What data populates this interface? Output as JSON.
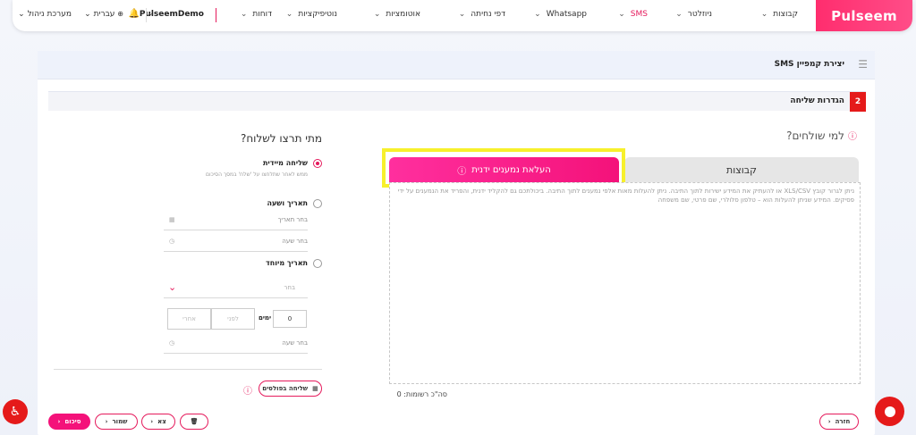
{
  "brand": {
    "logo": "Pulseem",
    "accent": "#e51a5c"
  },
  "nav": {
    "items": [
      {
        "label": "קבוצות"
      },
      {
        "label": "ניוזלטר"
      },
      {
        "label": "SMS"
      },
      {
        "label": "Whatsapp"
      },
      {
        "label": "דפי נחיתה"
      },
      {
        "label": "אוטומציות"
      },
      {
        "label": "נוטיפיקציות"
      },
      {
        "label": "דוחות"
      }
    ],
    "account": "PulseemDemo",
    "language": "עברית",
    "admin": "מערכת ניהול"
  },
  "page": {
    "title": "יצירת קמפיין SMS",
    "step_number": "2",
    "step_label": "הגדרות שליחה"
  },
  "recipients": {
    "title": "למי שולחים?",
    "tab_groups": "קבוצות",
    "tab_upload": "העלאת נמענים ידנית",
    "upload_text": "ניתן לגרור קובץ XLS/CSV  או להעתיק את המידע ישירות לתוך התיבה. ניתן להעלות מאות אלפי נמענים לתוך התיבה. ביכולתכם גם להקליד ידנית, והפריד את הנמענים על ידי פסיקים. המידע שניתן להעלות הוא – טלפון סלולרי, שם פרטי, שם משפחה",
    "records": "סה\"כ רשומות: 0"
  },
  "when": {
    "title": "מתי תרצו לשלוח?",
    "immediate_label": "שליחה מיידית",
    "immediate_sub": "ממש לאחר שתלחצו על 'שלח' במסך הסיכום",
    "datetime_label": "תאריך ושעה",
    "date_placeholder": "בחר תאריך",
    "time_placeholder": "בחר שעה",
    "special_label": "תאריך מיוחד",
    "select_placeholder": "בחר",
    "days_value": "0",
    "days_label": "ימים",
    "before": "לפני",
    "after": "אחרי",
    "time2_placeholder": "בחר שעה",
    "send_in_parts": "שליחה בפולסים"
  },
  "footer": {
    "back": "חזרה",
    "summary": "סיכום",
    "save": "שמור",
    "exit": "צא"
  }
}
